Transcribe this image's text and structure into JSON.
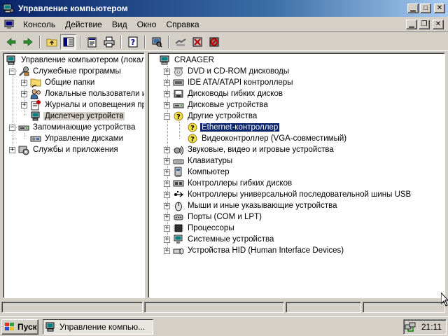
{
  "window": {
    "title": "Управление компьютером"
  },
  "menu": {
    "items": [
      "Консоль",
      "Действие",
      "Вид",
      "Окно",
      "Справка"
    ]
  },
  "left_tree": {
    "root": "Управление компьютером (локаль",
    "utilities": "Служебные программы",
    "shared_folders": "Общие папки",
    "local_users": "Локальные пользователи и",
    "event_logs": "Журналы и оповещения пр",
    "device_manager": "Диспетчер устройств",
    "storage": "Запоминающие устройства",
    "disk_management": "Управление дисками",
    "services": "Службы и приложения"
  },
  "right_tree": {
    "root": "CRAAGER",
    "categories": [
      "DVD и CD-ROM дисководы",
      "IDE ATA/ATAPI контроллеры",
      "Дисководы гибких дисков",
      "Дисковые устройства",
      "Другие устройства",
      "Ethernet-контроллер",
      "Видеоконтроллер (VGA-совместимый)",
      "Звуковые, видео и игровые устройства",
      "Клавиатуры",
      "Компьютер",
      "Контроллеры гибких дисков",
      "Контроллеры универсальной последовательной шины USB",
      "Мыши и иные указывающие устройства",
      "Порты (COM и LPT)",
      "Процессоры",
      "Системные устройства",
      "Устройства HID (Human Interface Devices)"
    ]
  },
  "taskbar": {
    "start": "Пуск",
    "window_button": "Управление компью...",
    "clock": "21:11"
  },
  "colors": {
    "selection": "#0a246a",
    "face": "#d4d0c8",
    "title_gradient_start": "#0a246a",
    "title_gradient_end": "#a6caf0"
  }
}
